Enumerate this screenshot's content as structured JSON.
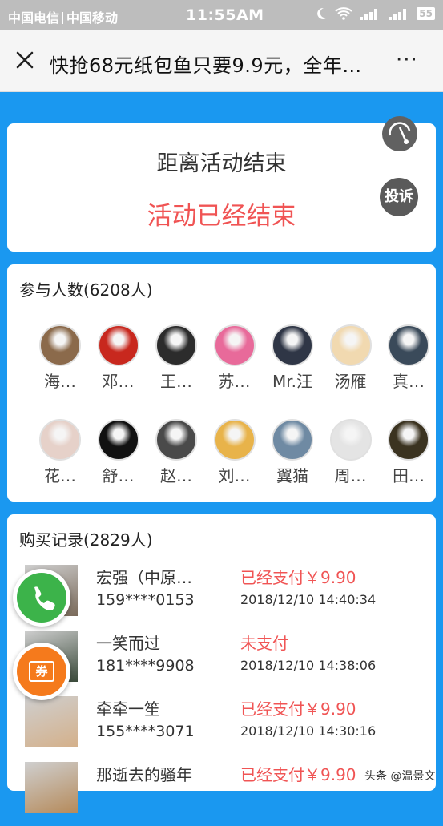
{
  "status_bar": {
    "carrier1": "中国电信",
    "carrier2": "中国移动",
    "time": "11:55AM",
    "battery": "55",
    "icons": [
      "moon-icon",
      "wifi-icon",
      "signal-icon",
      "signal-icon",
      "battery-icon"
    ]
  },
  "nav": {
    "title": "快抢68元纸包鱼只要9.9元，全年…",
    "more": "···",
    "close_icon": "close-icon"
  },
  "countdown": {
    "label": "距离活动结束",
    "status": "活动已经结束"
  },
  "complaint_label": "投诉",
  "participants": {
    "header": "参与人数(6208人)",
    "people": [
      {
        "name": "海…",
        "color": "#8b6a4b"
      },
      {
        "name": "邓…",
        "color": "#c8281e"
      },
      {
        "name": "王…",
        "color": "#2c2c2c"
      },
      {
        "name": "苏…",
        "color": "#e86a9a"
      },
      {
        "name": "Mr.汪",
        "color": "#2f3646"
      },
      {
        "name": "汤雁",
        "color": "#f1d9b0"
      },
      {
        "name": "真…",
        "color": "#3a4a5a"
      },
      {
        "name": "花…",
        "color": "#e6d1c9"
      },
      {
        "name": "舒…",
        "color": "#111111"
      },
      {
        "name": "赵…",
        "color": "#4a4a4a"
      },
      {
        "name": "刘…",
        "color": "#e8b34a"
      },
      {
        "name": "翼猫",
        "color": "#6f8aa3"
      },
      {
        "name": "周…",
        "color": "#e4e4e4"
      },
      {
        "name": "田…",
        "color": "#3b3320"
      }
    ]
  },
  "records": {
    "header": "购买记录(2829人)",
    "items": [
      {
        "name": "宏强（中原…",
        "phone": "159****0153",
        "status": "已经支付￥9.90",
        "time": "2018/12/10 14:40:34",
        "color": "#7a6a5a"
      },
      {
        "name": "一笑而过",
        "phone": "181****9908",
        "status": "未支付",
        "time": "2018/12/10 14:38:06",
        "color": "#3a4a3a"
      },
      {
        "name": "牵牵一笙",
        "phone": "155****3071",
        "status": "已经支付￥9.90",
        "time": "2018/12/10 14:30:16",
        "color": "#d4b08a"
      },
      {
        "name": "那逝去的骚年",
        "phone": "",
        "status": "已经支付￥9.90",
        "time": "",
        "color": "#b58a5a"
      }
    ]
  },
  "coupon_label": "券",
  "watermark": "头条 @温景文",
  "colors": {
    "page_bg": "#1a98f0",
    "accent_red": "#f05454",
    "call_green": "#3cb34a",
    "coupon_orange": "#f57a1c"
  }
}
